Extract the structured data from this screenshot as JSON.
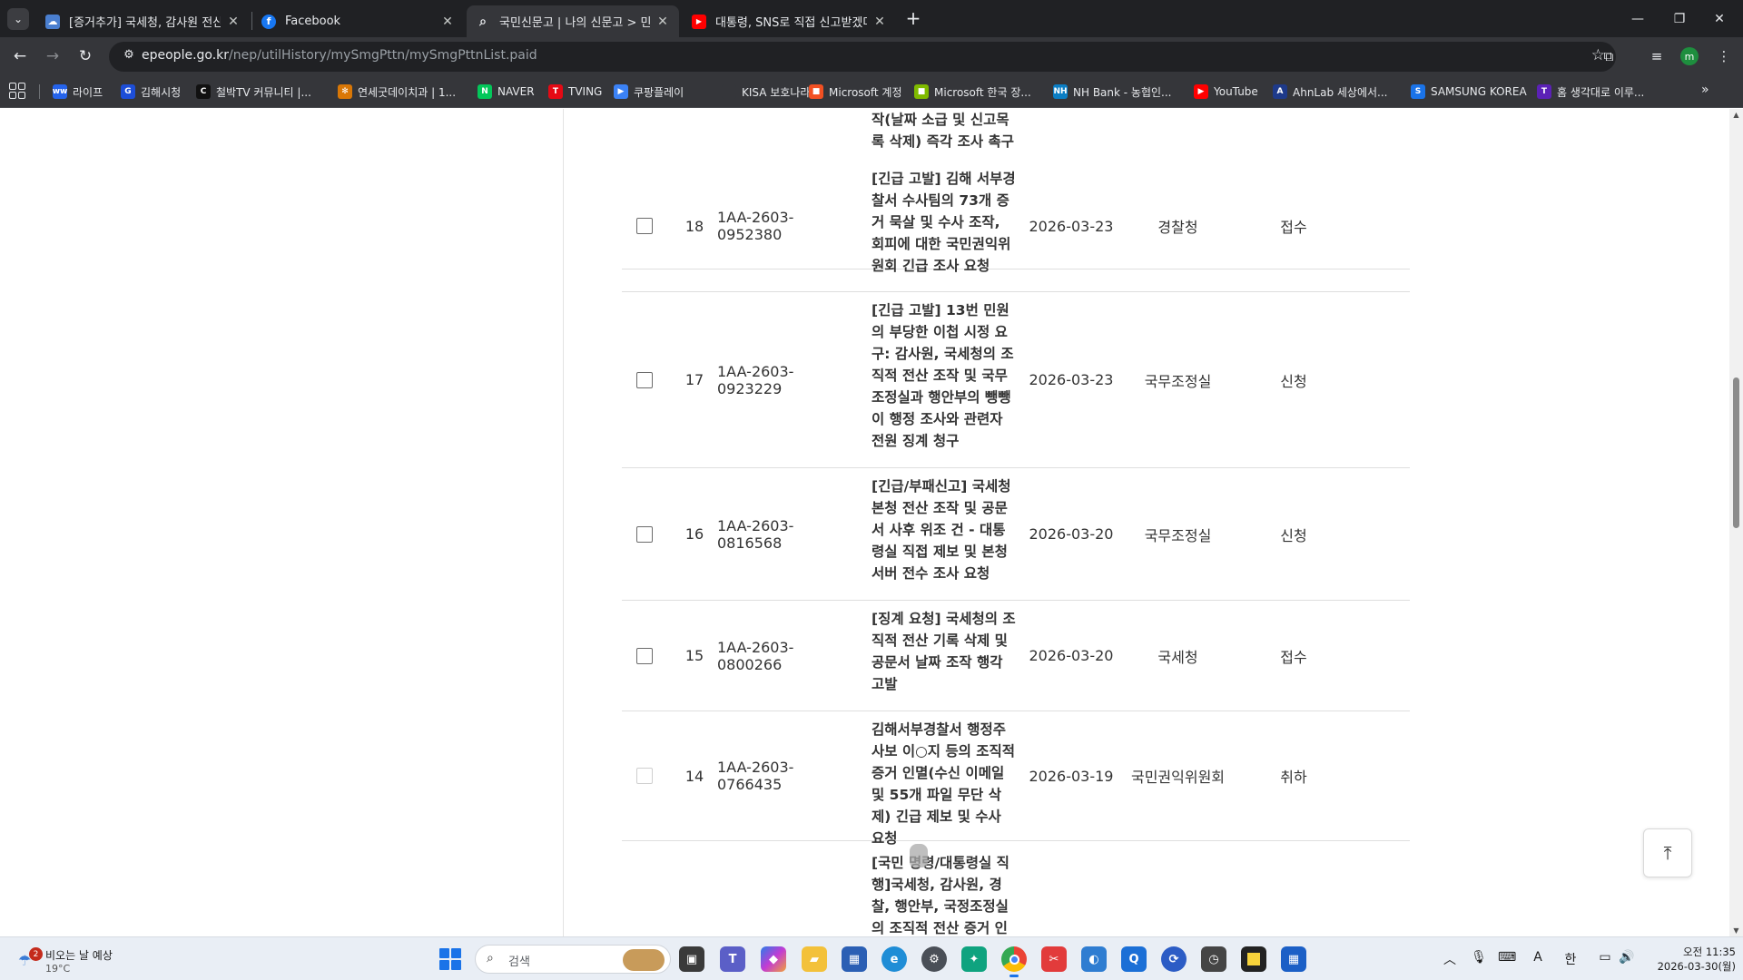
{
  "tabs": [
    {
      "title": "[증거추가] 국세청, 감사원 전산",
      "icon": "cloud-icon",
      "active": false
    },
    {
      "title": "Facebook",
      "icon": "facebook-icon",
      "active": false
    },
    {
      "title": "국민신문고 | 나의 신문고 > 민",
      "icon": "search-globe-icon",
      "active": true
    },
    {
      "title": "대통령, SNS로 직접 신고받겠다",
      "icon": "youtube-icon",
      "active": false
    }
  ],
  "toolbar": {
    "url_host": "epeople.go.kr",
    "url_path": "/nep/utilHistory/mySmgPttn/mySmgPttnList.paid",
    "profile_initial": "m"
  },
  "bookmarks": [
    {
      "label": "라이프",
      "icon": "ww-icon",
      "color": "#2563eb",
      "glyph": "ww"
    },
    {
      "label": "김해시청",
      "icon": "gimhae-icon",
      "color": "#1d4ed8",
      "glyph": "G"
    },
    {
      "label": "철박TV 커뮤니티 |...",
      "icon": "chulbak-icon",
      "color": "#111111",
      "glyph": "C"
    },
    {
      "label": "연세굿데이치과 | 1...",
      "icon": "dental-icon",
      "color": "#d97706",
      "glyph": "✻"
    },
    {
      "label": "NAVER",
      "icon": "naver-icon",
      "color": "#03c75a",
      "glyph": "N"
    },
    {
      "label": "TVING",
      "icon": "tving-icon",
      "color": "#e50914",
      "glyph": "T"
    },
    {
      "label": "쿠팡플레이",
      "icon": "coupang-icon",
      "color": "#3b82f6",
      "glyph": "▶"
    },
    {
      "label": "KISA 보호나라",
      "icon": "kisa-icon",
      "color": "#35363a",
      "glyph": ""
    },
    {
      "label": "Microsoft 계정",
      "icon": "microsoft-icon",
      "color": "#f25022",
      "glyph": "■"
    },
    {
      "label": "Microsoft 한국 장...",
      "icon": "microsoft-icon",
      "color": "#7fba00",
      "glyph": "■"
    },
    {
      "label": "NH Bank - 농협인...",
      "icon": "nh-icon",
      "color": "#0b7ec4",
      "glyph": "NH"
    },
    {
      "label": "YouTube",
      "icon": "youtube-icon",
      "color": "#ff0000",
      "glyph": "▶"
    },
    {
      "label": "AhnLab  세상에서...",
      "icon": "ahnlab-icon",
      "color": "#1e3a8a",
      "glyph": "A"
    },
    {
      "label": "SAMSUNG KOREA",
      "icon": "samsung-icon",
      "color": "#1a73e8",
      "glyph": "S"
    },
    {
      "label": "홈  생각대로 이루...",
      "icon": "t-icon",
      "color": "#5b21b6",
      "glyph": "T"
    }
  ],
  "partial_top_row": {
    "title": "작(날짜 소급 및 신고목록 삭제) 즉각 조사 촉구"
  },
  "rows": [
    {
      "num": "18",
      "id": "1AA-2603-0952380",
      "title": "[긴급 고발] 김해 서부경찰서 수사팀의 73개 증거 묵살 및 수사 조작, 회피에 대한 국민권익위원회 긴급 조사 요청",
      "date": "2026-03-23",
      "org": "경찰청",
      "status": "접수",
      "checkbox_enabled": true
    },
    {
      "num": "17",
      "id": "1AA-2603-0923229",
      "title": "[긴급 고발] 13번 민원의 부당한 이첩 시정 요구: 감사원, 국세청의 조직적 전산 조작 및 국무조정실과 행안부의 뺑뺑이 행정 조사와 관련자 전원 징계 청구",
      "date": "2026-03-23",
      "org": "국무조정실",
      "status": "신청",
      "checkbox_enabled": true
    },
    {
      "num": "16",
      "id": "1AA-2603-0816568",
      "title": "[긴급/부패신고] 국세청 본청 전산 조작 및 공문서 사후 위조 건 - 대통령실 직접 제보 및 본청 서버 전수 조사 요청",
      "date": "2026-03-20",
      "org": "국무조정실",
      "status": "신청",
      "checkbox_enabled": true
    },
    {
      "num": "15",
      "id": "1AA-2603-0800266",
      "title": "[징계 요청] 국세청의 조직적 전산 기록 삭제 및 공문서 날짜 조작 행각 고발",
      "date": "2026-03-20",
      "org": "국세청",
      "status": "접수",
      "checkbox_enabled": true
    },
    {
      "num": "14",
      "id": "1AA-2603-0766435",
      "title": "김해서부경찰서 행정주사보 이○지 등의 조직적 증거 인멸(수신 이메일 및 55개 파일 무단 삭제) 긴급 제보 및 수사 요청",
      "date": "2026-03-19",
      "org": "국민권익위원회",
      "status": "취하",
      "checkbox_enabled": false
    }
  ],
  "partial_bottom_row": {
    "title": "[국민 명령/대통령실 직행]국세청, 감사원, 경찰, 행안부, 국정조정실의 조직적 전산 증거 인멸 및"
  },
  "taskbar": {
    "weather_text": "비오는 날 예상",
    "weather_temp": "19°C",
    "weather_badge": "2",
    "search_placeholder": "검색",
    "ime": "한",
    "font_indicator": "A",
    "clock_time": "오전 11:35",
    "clock_date": "2026-03-30(월)"
  }
}
